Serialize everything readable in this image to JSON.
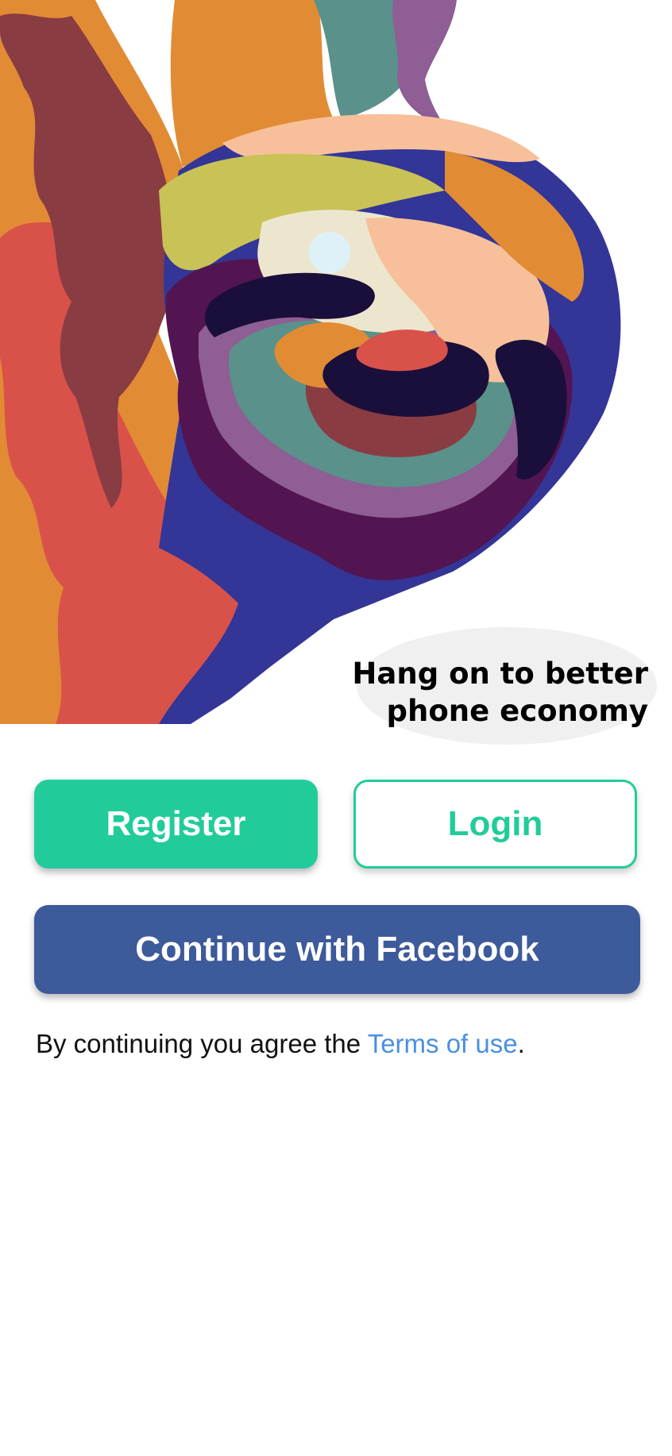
{
  "hero": {
    "image_name": "sloth-illustration",
    "tagline_line1": "Hang on to better",
    "tagline_line2": "phone economy"
  },
  "actions": {
    "register_label": "Register",
    "login_label": "Login",
    "facebook_label": "Continue with Facebook"
  },
  "terms": {
    "prefix": "By continuing you agree the ",
    "link_label": "Terms of use",
    "suffix": "."
  },
  "colors": {
    "primary_green": "#22cc9a",
    "facebook_blue": "#3d5a9b",
    "link_blue": "#4a8fe0"
  }
}
